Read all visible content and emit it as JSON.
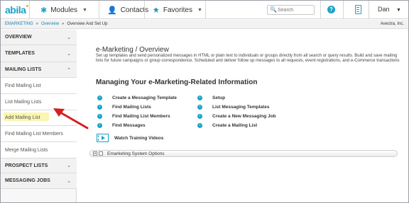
{
  "app": {
    "logo": "abila"
  },
  "topnav": {
    "modules": "Modules",
    "contacts": "Contacts",
    "favorites": "Favorites",
    "search_placeholder": "Search",
    "help": "?",
    "user": "Dan"
  },
  "breadcrumb": {
    "items": [
      "EMARKETING",
      "Overview",
      "Overview And Set Up"
    ],
    "org": "Avectra, Inc."
  },
  "sidebar": {
    "overview": "OVERVIEW",
    "templates": "TEMPLATES",
    "mailing_lists": "MAILING LISTS",
    "items": [
      "Find Mailing List",
      "List Mailing Lists",
      "Add Mailing List",
      "Find Mailing List Members",
      "Merge Mailing Lists"
    ],
    "prospect_lists": "PROSPECT LISTS",
    "messaging_jobs": "MESSAGING JOBS"
  },
  "main": {
    "title": "e-Marketing / Overview",
    "description": "Set up templates and send personalized messages in HTML or plain text to individuals or groups directly from all search or query results. Build and save mailing lists for future campaigns or group correspondence. Scheduled and deliver follow up messages to all requests, event registrations, and e-Commerce transactions",
    "section_title": "Managing Your e-Marketing-Related Information",
    "left_links": [
      "Create a Messaging Template",
      "Find Mailing Lists",
      "Find Mailing List Members",
      "Find Messages"
    ],
    "right_links": [
      "Setup",
      "List Messaging Templates",
      "Create a New Messaging Job",
      "Create a Mailing List"
    ],
    "training": "Watch Training Videos",
    "system_options": "Emarketing System Options"
  },
  "colors": {
    "accent": "#1aa3c7",
    "highlight": "#fbf6b0",
    "arrow": "#d42020"
  }
}
